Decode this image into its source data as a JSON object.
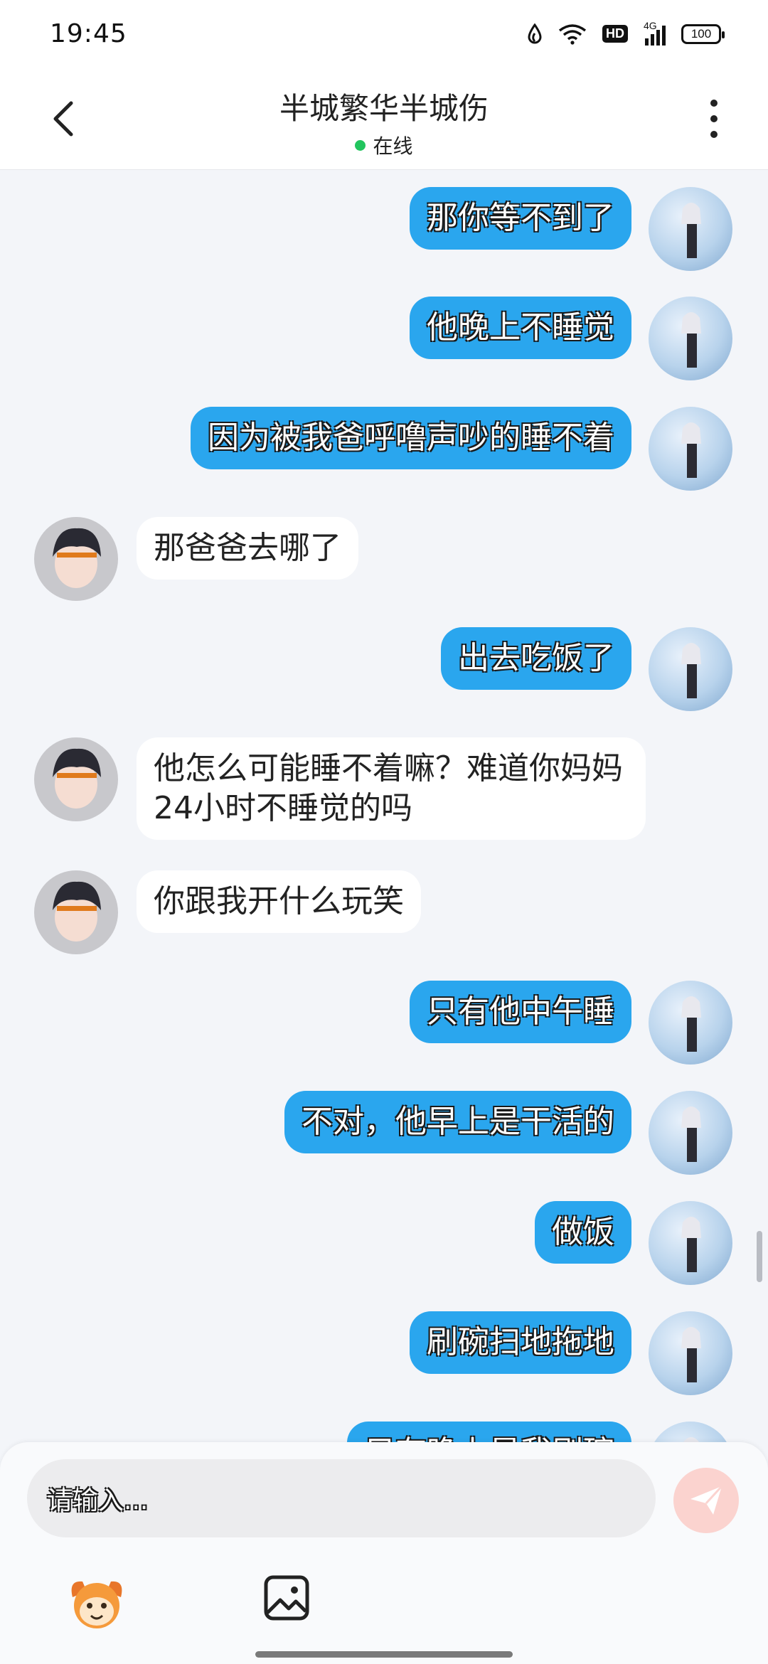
{
  "status_bar": {
    "time": "19:45",
    "hd_badge": "HD",
    "network": "4G",
    "battery": "100"
  },
  "header": {
    "title": "半城繁华半城伤",
    "status": "在线"
  },
  "messages": [
    {
      "sender": "me",
      "text": "那你等不到了"
    },
    {
      "sender": "me",
      "text": "他晚上不睡觉"
    },
    {
      "sender": "me",
      "text": "因为被我爸呼噜声吵的睡不着"
    },
    {
      "sender": "other",
      "text": "那爸爸去哪了"
    },
    {
      "sender": "me",
      "text": "出去吃饭了"
    },
    {
      "sender": "other",
      "text": "他怎么可能睡不着嘛？难道你妈妈24小时不睡觉的吗"
    },
    {
      "sender": "other",
      "text": "你跟我开什么玩笑"
    },
    {
      "sender": "me",
      "text": "只有他中午睡"
    },
    {
      "sender": "me",
      "text": "不对，他早上是干活的"
    },
    {
      "sender": "me",
      "text": "做饭"
    },
    {
      "sender": "me",
      "text": "刷碗扫地拖地"
    },
    {
      "sender": "me",
      "text": "只有晚上是我刷碗"
    }
  ],
  "composer": {
    "placeholder": "请输入..."
  },
  "icons": {
    "back": "chevron-left-icon",
    "more": "more-vertical-icon",
    "send": "send-icon",
    "emoji": "mascot-emoji-icon",
    "image": "image-icon"
  },
  "colors": {
    "my_bubble": "#2aa6ee",
    "other_bubble": "#ffffff",
    "online": "#22c55e",
    "send_button": "#fbd3cf"
  }
}
